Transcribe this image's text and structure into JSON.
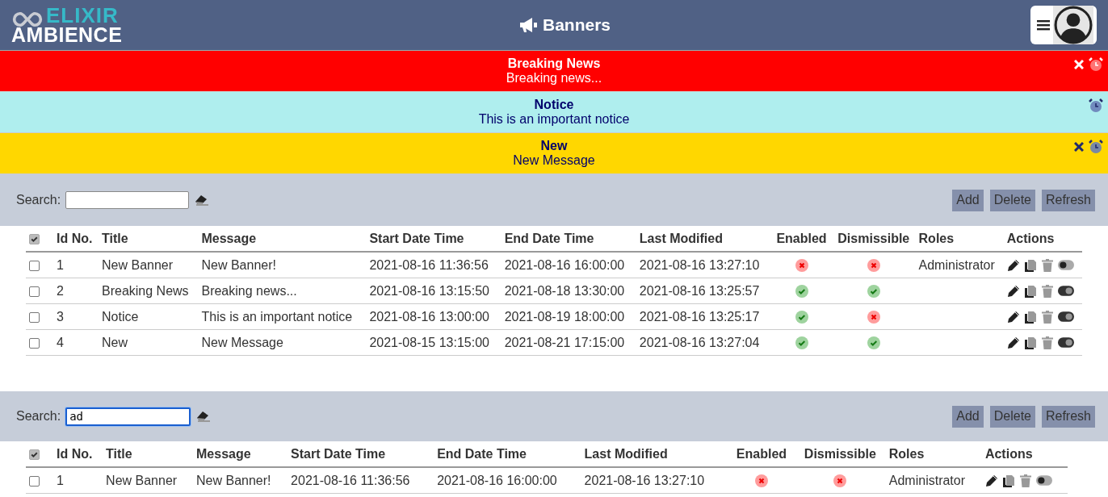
{
  "header": {
    "logo_top": "ELIXIR",
    "logo_bottom": "AMBIENCE",
    "title": "Banners"
  },
  "banners": [
    {
      "title": "Breaking News",
      "message": "Breaking news...",
      "color": "#ff0000",
      "dismissible": true
    },
    {
      "title": "Notice",
      "message": "This is an important notice",
      "color": "#afeeee",
      "dismissible": false
    },
    {
      "title": "New",
      "message": "New Message",
      "color": "#ffd700",
      "dismissible": true
    }
  ],
  "panels": [
    {
      "search_label": "Search:",
      "focused": false,
      "buttons": [
        "Add",
        "Delete",
        "Refresh"
      ],
      "columns": [
        "Id No.",
        "Title",
        "Message",
        "Start Date Time",
        "End Date Time",
        "Last Modified",
        "Enabled",
        "Dismissible",
        "Roles",
        "Actions"
      ],
      "select_all_checked": true,
      "rows": [
        {
          "selected": false,
          "id": "1",
          "title": "New Banner",
          "message": "New Banner!",
          "start": "2021-08-16 11:36:56",
          "end": "2021-08-16 16:00:00",
          "modified": "2021-08-16 13:27:10",
          "enabled": false,
          "dismissible": false,
          "roles": "Administrator"
        },
        {
          "selected": false,
          "id": "2",
          "title": "Breaking News",
          "message": "Breaking news...",
          "start": "2021-08-16 13:15:50",
          "end": "2021-08-18 13:30:00",
          "modified": "2021-08-16 13:25:57",
          "enabled": true,
          "dismissible": true
        },
        {
          "selected": false,
          "id": "3",
          "title": "Notice",
          "message": "This is an important notice",
          "start": "2021-08-16 13:00:00",
          "end": "2021-08-19 18:00:00",
          "modified": "2021-08-16 13:25:17",
          "enabled": true,
          "dismissible": false
        },
        {
          "selected": false,
          "id": "4",
          "title": "New",
          "message": "New Message",
          "start": "2021-08-15 13:15:00",
          "end": "2021-08-21 17:15:00",
          "modified": "2021-08-16 13:27:04",
          "enabled": true,
          "dismissible": true
        }
      ]
    },
    {
      "search_label": "Search:",
      "search_value": "ad",
      "focused": true,
      "buttons": [
        "Add",
        "Delete",
        "Refresh"
      ],
      "columns": [
        "Id No.",
        "Title",
        "Message",
        "Start Date Time",
        "End Date Time",
        "Last Modified",
        "Enabled",
        "Dismissible",
        "Roles",
        "Actions"
      ],
      "select_all_checked": true,
      "rows": [
        {
          "selected": false,
          "id": "1",
          "title": "New Banner",
          "message": "New Banner!",
          "start": "2021-08-16 11:36:56",
          "end": "2021-08-16 16:00:00",
          "modified": "2021-08-16 13:27:10",
          "enabled": false,
          "dismissible": false,
          "roles": "Administrator"
        }
      ]
    }
  ]
}
